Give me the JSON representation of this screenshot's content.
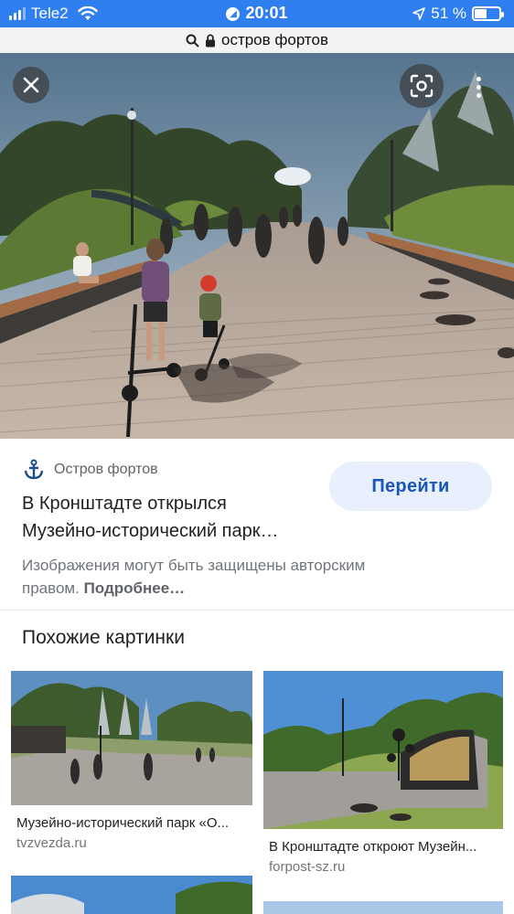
{
  "status_bar": {
    "carrier": "Tele2",
    "time": "20:01",
    "battery": "51 %",
    "battery_level": 0.51
  },
  "url_bar": {
    "query": "остров фортов"
  },
  "hero": {
    "icons": [
      "close-icon",
      "lens-icon",
      "more-vert-icon"
    ]
  },
  "result": {
    "source_name": "Остров фортов",
    "source_icon": "anchor-icon",
    "title_line1": "В Кронштадте открылся",
    "title_line2": "Музейно-исторический парк…",
    "go_button": "Перейти",
    "copyright_text": "Изображения могут быть защищены авторским правом.",
    "more_link": "Подробнее…"
  },
  "similar": {
    "heading": "Похожие картинки",
    "items": [
      {
        "caption": "Музейно-исторический парк «О...",
        "domain": "tvzvezda.ru"
      },
      {
        "caption": "В Кронштадте откроют Музейн...",
        "domain": "forpost-sz.ru"
      }
    ]
  },
  "colors": {
    "status_bar": "#2f7ff0",
    "button_bg": "#e8f0fe",
    "button_text": "#1a56b8",
    "source_icon": "#1a4d8c"
  }
}
